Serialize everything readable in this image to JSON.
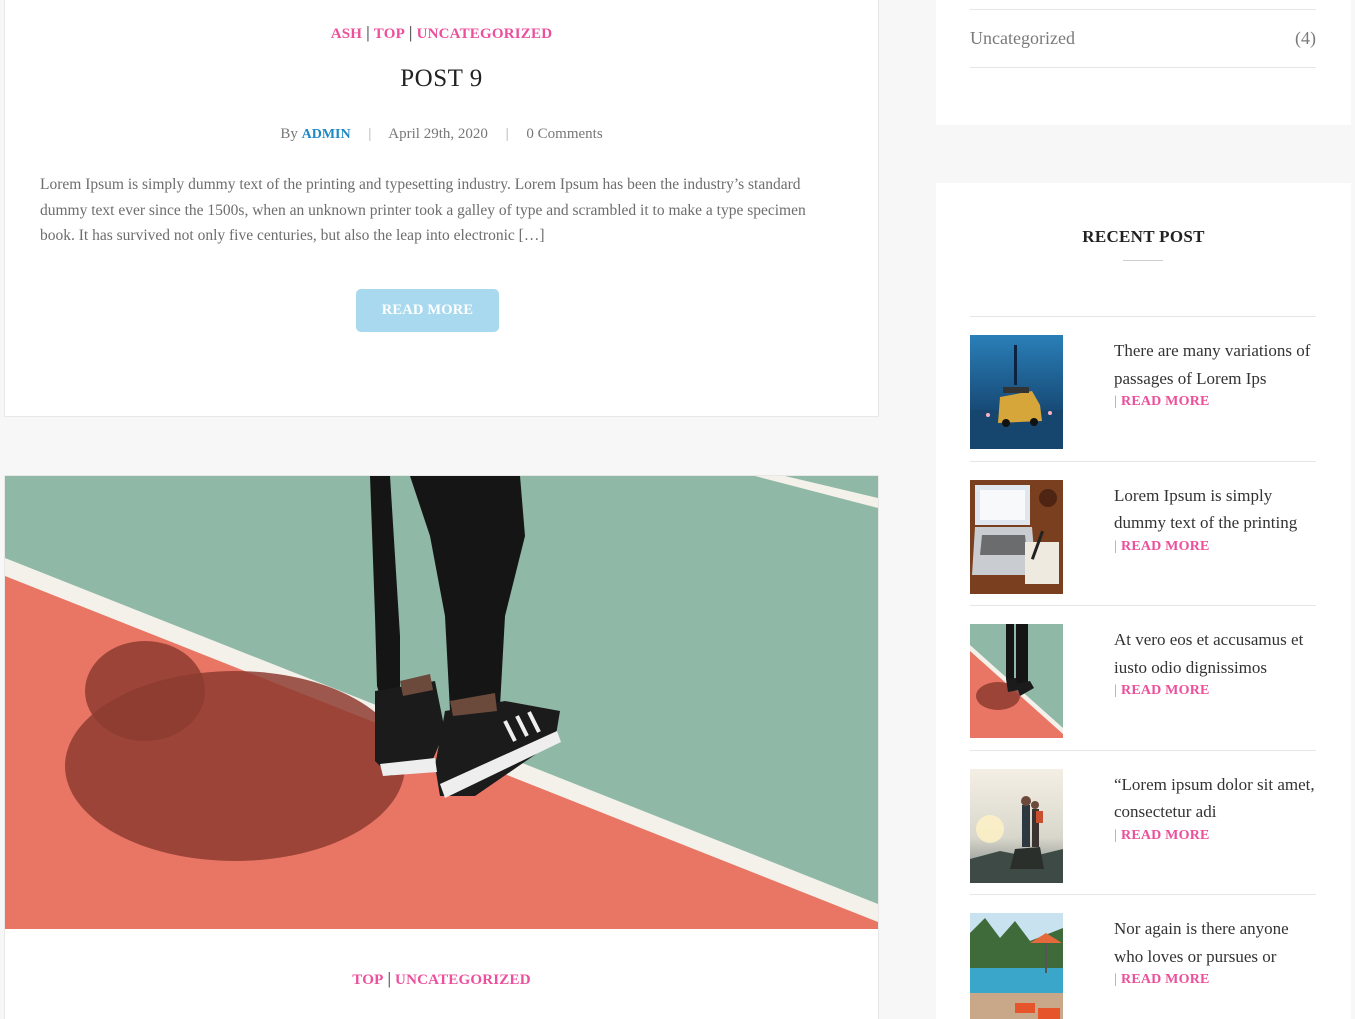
{
  "post9": {
    "categories": [
      "ASH",
      "TOP",
      "UNCATEGORIZED"
    ],
    "title": "POST 9",
    "by_label": "By",
    "author": "ADMIN",
    "date": "April 29th, 2020",
    "comments": "0 Comments",
    "excerpt": "Lorem Ipsum is simply dummy text of the printing and typesetting industry. Lorem Ipsum has been the industry’s standard dummy text ever since the 1500s, when an unknown printer took a galley of type and scrambled it to make a type specimen book. It has survived not only five centuries, but also the leap into electronic […]",
    "read_more": "READ MORE"
  },
  "next_post": {
    "categories": [
      "TOP",
      "UNCATEGORIZED"
    ]
  },
  "sidebar": {
    "categories_widget": {
      "item_label": "Uncategorized",
      "item_count": "(4)"
    },
    "recent": {
      "title": "RECENT POST",
      "read_more": "READ MORE",
      "items": [
        {
          "title": "There are many variations of passages of Lorem Ips"
        },
        {
          "title": "Lorem Ipsum is simply dummy text of the printing"
        },
        {
          "title": "At vero eos et accusamus et iusto odio dignissimos"
        },
        {
          "title": "“Lorem ipsum dolor sit amet, consectetur adi"
        },
        {
          "title": "Nor again is there anyone who loves or pursues or"
        }
      ]
    }
  },
  "colors": {
    "accent_pink": "#ec4f9b",
    "author_blue": "#1e88c7",
    "button_blue": "#a8d9ef"
  }
}
